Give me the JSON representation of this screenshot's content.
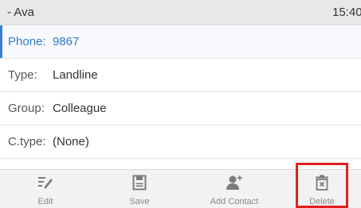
{
  "header": {
    "title": "- Ava",
    "time": "15:40"
  },
  "fields": [
    {
      "label": "Phone:",
      "value": "9867",
      "active": true
    },
    {
      "label": "Type:",
      "value": "Landline"
    },
    {
      "label": "Group:",
      "value": "Colleague"
    },
    {
      "label": "C.type:",
      "value": "(None)"
    }
  ],
  "softkeys": [
    {
      "label": "Edit",
      "icon": "edit-icon"
    },
    {
      "label": "Save",
      "icon": "save-icon"
    },
    {
      "label": "Add Contact",
      "icon": "add-contact-icon"
    },
    {
      "label": "Delete",
      "icon": "delete-icon",
      "highlighted": true
    }
  ],
  "colors": {
    "accent": "#2f7ad0",
    "highlight": "#e02020"
  }
}
